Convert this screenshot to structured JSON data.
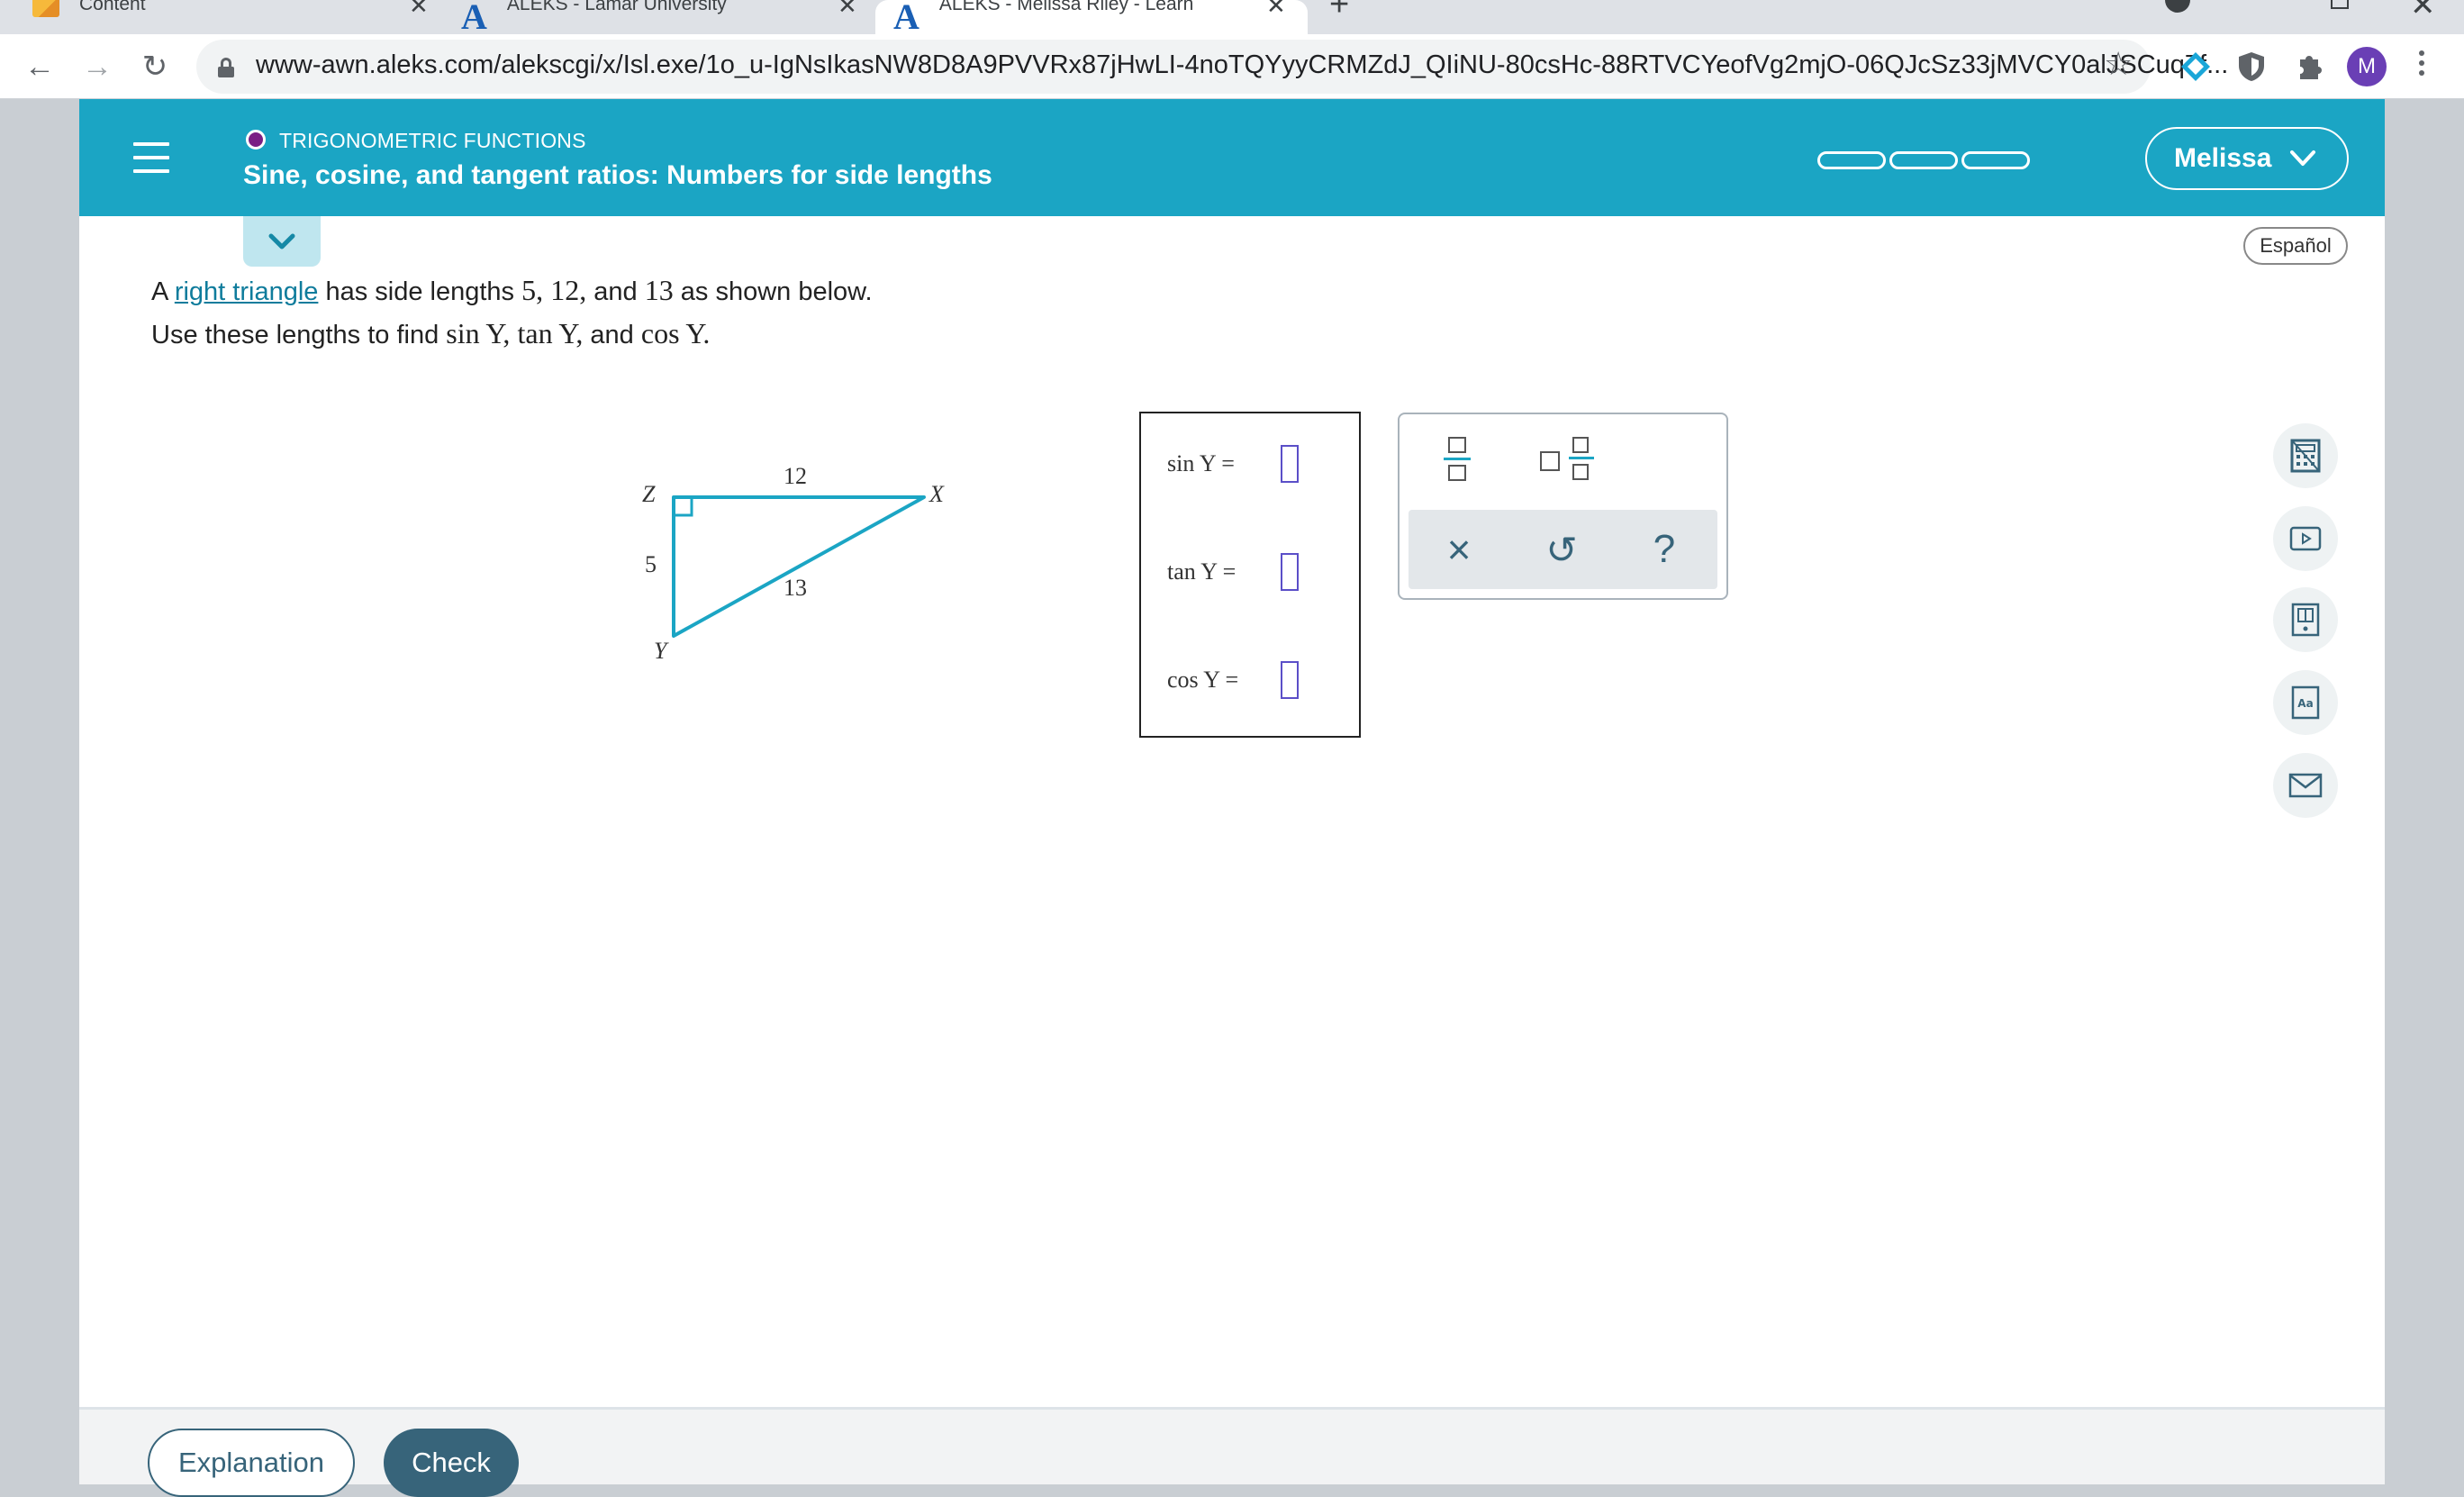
{
  "browser": {
    "tabs": [
      {
        "title": "Content",
        "close": "✕"
      },
      {
        "title": "ALEKS - Lamar University",
        "close": "✕"
      },
      {
        "title": "ALEKS - Melissa Riley - Learn",
        "close": "✕"
      }
    ],
    "new_tab": "+",
    "url": "www-awn.aleks.com/alekscgi/x/Isl.exe/1o_u-IgNsIkasNW8D8A9PVVRx87jHwLI-4noTQYyyCRMZdJ_QIiNU-80csHc-88RTVCYeofVg2mjO-06QJcSz33jMVCY0alJSCuq7f...",
    "profile_initial": "M",
    "accent_color": "#1ba5c4"
  },
  "header": {
    "topic": "TRIGONOMETRIC FUNCTIONS",
    "title": "Sine, cosine, and tangent ratios: Numbers for side lengths",
    "user_name": "Melissa",
    "language_button": "Español",
    "progress_segments": 3
  },
  "problem": {
    "line1_prefix": "A",
    "line1_link": "right triangle",
    "line1_mid": "has side lengths",
    "side_a": "5,",
    "side_b": "12,",
    "and_word": "and",
    "side_c": "13",
    "line1_suffix": "as shown below.",
    "line2_prefix": "Use these lengths to find",
    "sin_expr": "sin Y,",
    "tan_expr": "tan Y,",
    "cos_expr": "cos Y."
  },
  "triangle": {
    "vertex_z": "Z",
    "vertex_x": "X",
    "vertex_y": "Y",
    "side_zx": "12",
    "side_zy": "5",
    "side_xy": "13"
  },
  "answers": [
    {
      "label": "sin Y ="
    },
    {
      "label": "tan Y ="
    },
    {
      "label": "cos Y ="
    }
  ],
  "keypad": {
    "clear": "×",
    "undo": "↺",
    "help": "?"
  },
  "footer": {
    "explanation": "Explanation",
    "check": "Check"
  }
}
